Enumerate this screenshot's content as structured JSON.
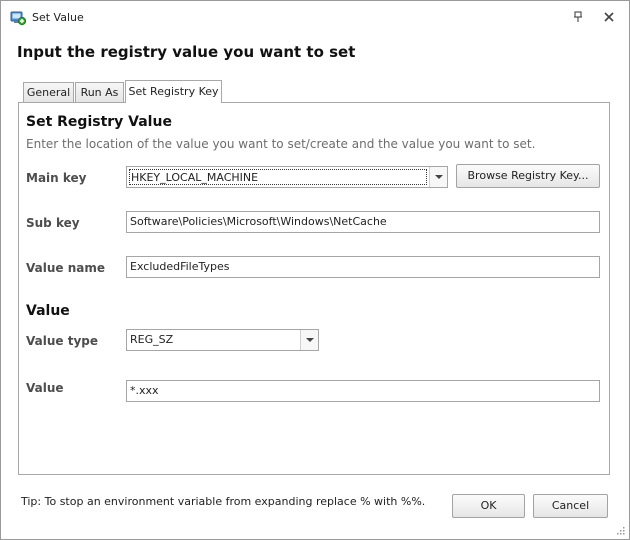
{
  "window": {
    "title": "Set Value",
    "icon": "registry-app-icon",
    "pin_icon": "pin-icon",
    "close_icon": "close-icon"
  },
  "header": {
    "title": "Input the registry value you want to set"
  },
  "tabs": [
    {
      "label": "General",
      "active": false
    },
    {
      "label": "Run As",
      "active": false
    },
    {
      "label": "Set Registry Key",
      "active": true
    }
  ],
  "registry": {
    "section_title": "Set Registry Value",
    "description": "Enter the location of the value you want to set/create and the value you want to set.",
    "main_key_label": "Main key",
    "main_key_value": "HKEY_LOCAL_MACHINE",
    "browse_label": "Browse Registry Key...",
    "sub_key_label": "Sub key",
    "sub_key_value": "Software\\Policies\\Microsoft\\Windows\\NetCache",
    "value_name_label": "Value name",
    "value_name_value": "ExcludedFileTypes"
  },
  "value_section": {
    "section_title": "Value",
    "type_label": "Value type",
    "type_value": "REG_SZ",
    "value_label": "Value",
    "value_value": "*.xxx"
  },
  "footer": {
    "tip": "Tip: To stop an environment variable from expanding replace % with %%.",
    "ok_label": "OK",
    "cancel_label": "Cancel"
  },
  "colors": {
    "label_gray": "#4d4d4d",
    "desc_gray": "#6d6d6d",
    "border": "#a6a6a6"
  }
}
